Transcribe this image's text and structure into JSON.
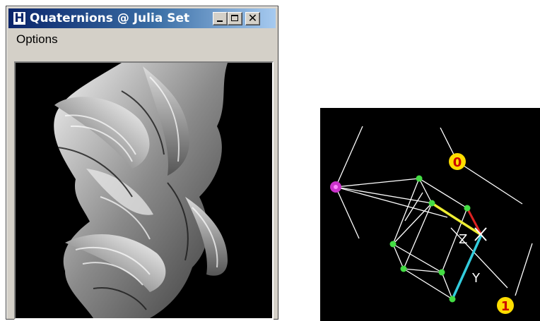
{
  "window": {
    "title": "Quaternions @ Julia Set",
    "app_icon_letter": "H",
    "close_glyph": "✕",
    "menu": [
      {
        "label": "Options"
      }
    ]
  },
  "fractal": {
    "description_icon": "julia-set-render",
    "background": "#000000",
    "surface_color": "#c8c8c8"
  },
  "diagram": {
    "background": "#000000",
    "axis_labels": {
      "z": "Z",
      "y": "Y"
    },
    "markers": {
      "top": "0",
      "bottom": "1"
    },
    "colors": {
      "line": "#ffffff",
      "node": "#44dd44",
      "eye": "#cc33cc",
      "marker": "#ffdd00",
      "marker_text": "#cc0000",
      "x_axis": "#dd2222",
      "y_axis": "#33ccdd",
      "z_axis": "#eeee33"
    }
  }
}
